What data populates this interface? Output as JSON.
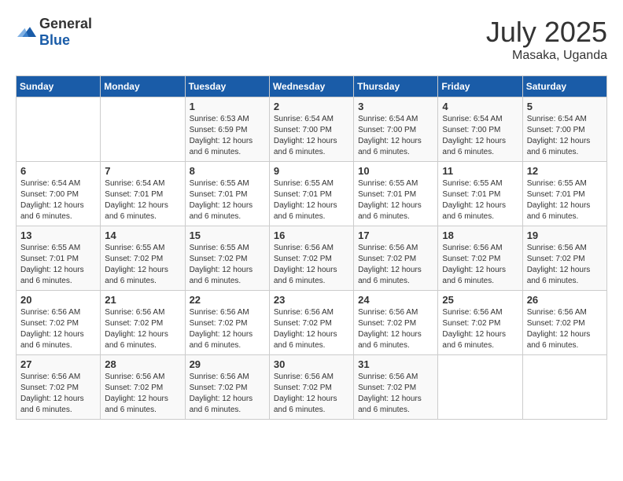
{
  "header": {
    "logo_general": "General",
    "logo_blue": "Blue",
    "month_year": "July 2025",
    "location": "Masaka, Uganda"
  },
  "days_of_week": [
    "Sunday",
    "Monday",
    "Tuesday",
    "Wednesday",
    "Thursday",
    "Friday",
    "Saturday"
  ],
  "weeks": [
    [
      {
        "day": "",
        "info": ""
      },
      {
        "day": "",
        "info": ""
      },
      {
        "day": "1",
        "sunrise": "Sunrise: 6:53 AM",
        "sunset": "Sunset: 6:59 PM",
        "daylight": "Daylight: 12 hours and 6 minutes."
      },
      {
        "day": "2",
        "sunrise": "Sunrise: 6:54 AM",
        "sunset": "Sunset: 7:00 PM",
        "daylight": "Daylight: 12 hours and 6 minutes."
      },
      {
        "day": "3",
        "sunrise": "Sunrise: 6:54 AM",
        "sunset": "Sunset: 7:00 PM",
        "daylight": "Daylight: 12 hours and 6 minutes."
      },
      {
        "day": "4",
        "sunrise": "Sunrise: 6:54 AM",
        "sunset": "Sunset: 7:00 PM",
        "daylight": "Daylight: 12 hours and 6 minutes."
      },
      {
        "day": "5",
        "sunrise": "Sunrise: 6:54 AM",
        "sunset": "Sunset: 7:00 PM",
        "daylight": "Daylight: 12 hours and 6 minutes."
      }
    ],
    [
      {
        "day": "6",
        "sunrise": "Sunrise: 6:54 AM",
        "sunset": "Sunset: 7:00 PM",
        "daylight": "Daylight: 12 hours and 6 minutes."
      },
      {
        "day": "7",
        "sunrise": "Sunrise: 6:54 AM",
        "sunset": "Sunset: 7:01 PM",
        "daylight": "Daylight: 12 hours and 6 minutes."
      },
      {
        "day": "8",
        "sunrise": "Sunrise: 6:55 AM",
        "sunset": "Sunset: 7:01 PM",
        "daylight": "Daylight: 12 hours and 6 minutes."
      },
      {
        "day": "9",
        "sunrise": "Sunrise: 6:55 AM",
        "sunset": "Sunset: 7:01 PM",
        "daylight": "Daylight: 12 hours and 6 minutes."
      },
      {
        "day": "10",
        "sunrise": "Sunrise: 6:55 AM",
        "sunset": "Sunset: 7:01 PM",
        "daylight": "Daylight: 12 hours and 6 minutes."
      },
      {
        "day": "11",
        "sunrise": "Sunrise: 6:55 AM",
        "sunset": "Sunset: 7:01 PM",
        "daylight": "Daylight: 12 hours and 6 minutes."
      },
      {
        "day": "12",
        "sunrise": "Sunrise: 6:55 AM",
        "sunset": "Sunset: 7:01 PM",
        "daylight": "Daylight: 12 hours and 6 minutes."
      }
    ],
    [
      {
        "day": "13",
        "sunrise": "Sunrise: 6:55 AM",
        "sunset": "Sunset: 7:01 PM",
        "daylight": "Daylight: 12 hours and 6 minutes."
      },
      {
        "day": "14",
        "sunrise": "Sunrise: 6:55 AM",
        "sunset": "Sunset: 7:02 PM",
        "daylight": "Daylight: 12 hours and 6 minutes."
      },
      {
        "day": "15",
        "sunrise": "Sunrise: 6:55 AM",
        "sunset": "Sunset: 7:02 PM",
        "daylight": "Daylight: 12 hours and 6 minutes."
      },
      {
        "day": "16",
        "sunrise": "Sunrise: 6:56 AM",
        "sunset": "Sunset: 7:02 PM",
        "daylight": "Daylight: 12 hours and 6 minutes."
      },
      {
        "day": "17",
        "sunrise": "Sunrise: 6:56 AM",
        "sunset": "Sunset: 7:02 PM",
        "daylight": "Daylight: 12 hours and 6 minutes."
      },
      {
        "day": "18",
        "sunrise": "Sunrise: 6:56 AM",
        "sunset": "Sunset: 7:02 PM",
        "daylight": "Daylight: 12 hours and 6 minutes."
      },
      {
        "day": "19",
        "sunrise": "Sunrise: 6:56 AM",
        "sunset": "Sunset: 7:02 PM",
        "daylight": "Daylight: 12 hours and 6 minutes."
      }
    ],
    [
      {
        "day": "20",
        "sunrise": "Sunrise: 6:56 AM",
        "sunset": "Sunset: 7:02 PM",
        "daylight": "Daylight: 12 hours and 6 minutes."
      },
      {
        "day": "21",
        "sunrise": "Sunrise: 6:56 AM",
        "sunset": "Sunset: 7:02 PM",
        "daylight": "Daylight: 12 hours and 6 minutes."
      },
      {
        "day": "22",
        "sunrise": "Sunrise: 6:56 AM",
        "sunset": "Sunset: 7:02 PM",
        "daylight": "Daylight: 12 hours and 6 minutes."
      },
      {
        "day": "23",
        "sunrise": "Sunrise: 6:56 AM",
        "sunset": "Sunset: 7:02 PM",
        "daylight": "Daylight: 12 hours and 6 minutes."
      },
      {
        "day": "24",
        "sunrise": "Sunrise: 6:56 AM",
        "sunset": "Sunset: 7:02 PM",
        "daylight": "Daylight: 12 hours and 6 minutes."
      },
      {
        "day": "25",
        "sunrise": "Sunrise: 6:56 AM",
        "sunset": "Sunset: 7:02 PM",
        "daylight": "Daylight: 12 hours and 6 minutes."
      },
      {
        "day": "26",
        "sunrise": "Sunrise: 6:56 AM",
        "sunset": "Sunset: 7:02 PM",
        "daylight": "Daylight: 12 hours and 6 minutes."
      }
    ],
    [
      {
        "day": "27",
        "sunrise": "Sunrise: 6:56 AM",
        "sunset": "Sunset: 7:02 PM",
        "daylight": "Daylight: 12 hours and 6 minutes."
      },
      {
        "day": "28",
        "sunrise": "Sunrise: 6:56 AM",
        "sunset": "Sunset: 7:02 PM",
        "daylight": "Daylight: 12 hours and 6 minutes."
      },
      {
        "day": "29",
        "sunrise": "Sunrise: 6:56 AM",
        "sunset": "Sunset: 7:02 PM",
        "daylight": "Daylight: 12 hours and 6 minutes."
      },
      {
        "day": "30",
        "sunrise": "Sunrise: 6:56 AM",
        "sunset": "Sunset: 7:02 PM",
        "daylight": "Daylight: 12 hours and 6 minutes."
      },
      {
        "day": "31",
        "sunrise": "Sunrise: 6:56 AM",
        "sunset": "Sunset: 7:02 PM",
        "daylight": "Daylight: 12 hours and 6 minutes."
      },
      {
        "day": "",
        "info": ""
      },
      {
        "day": "",
        "info": ""
      }
    ]
  ]
}
